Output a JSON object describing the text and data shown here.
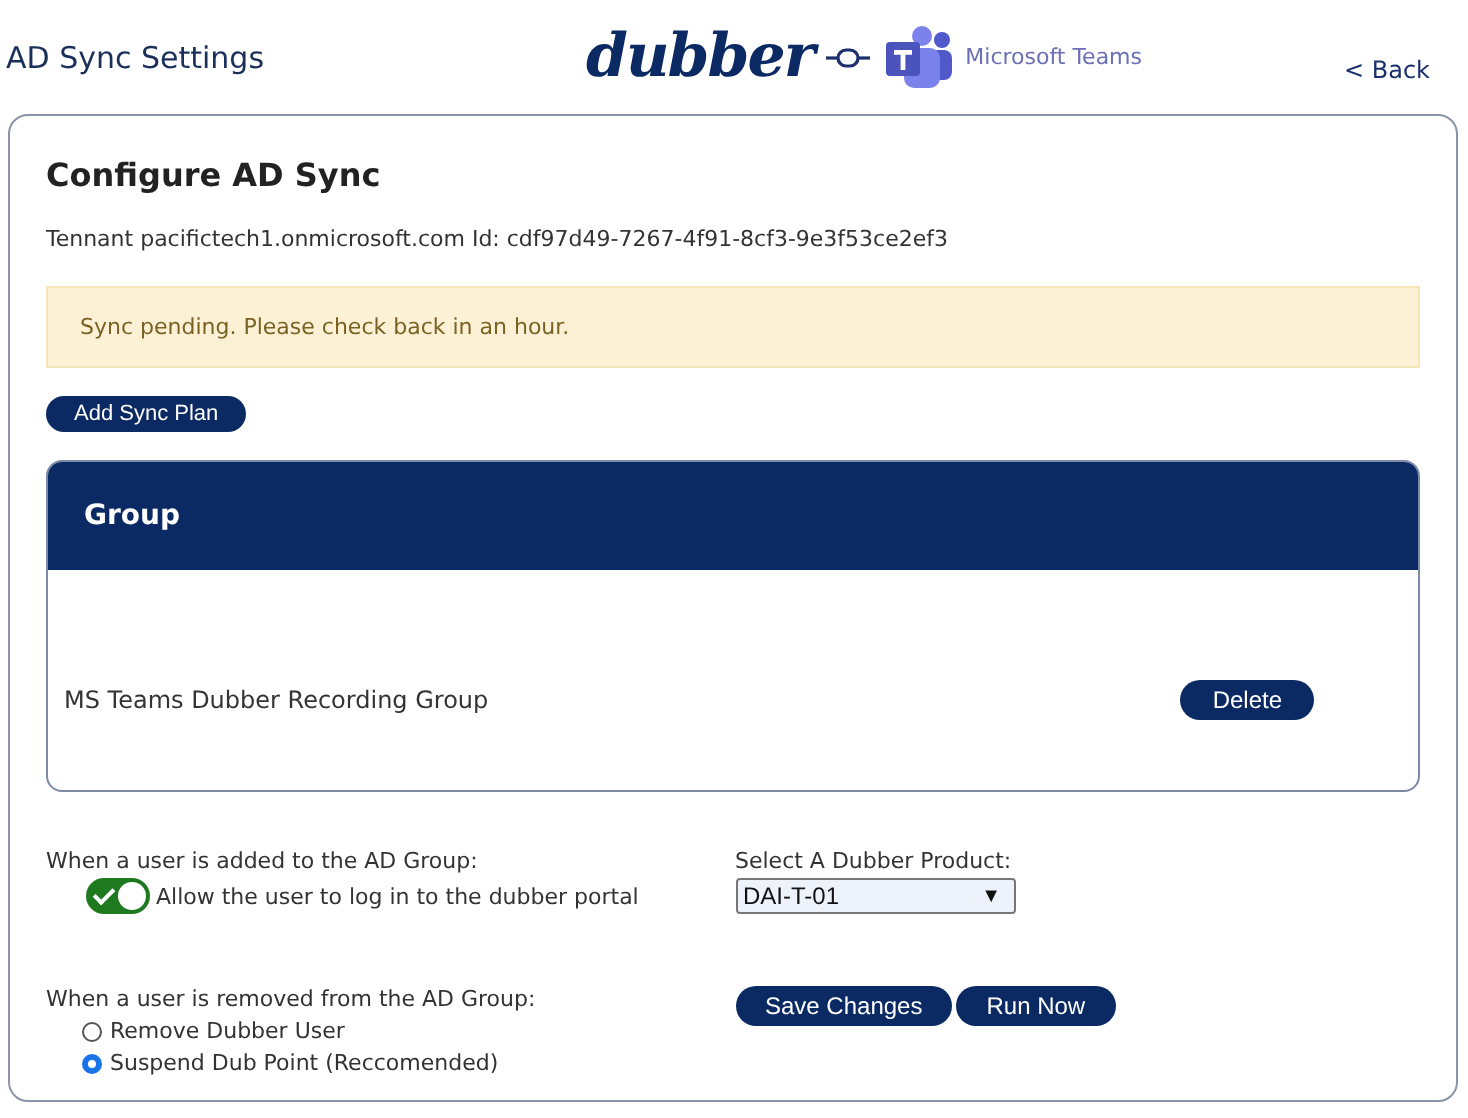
{
  "header": {
    "title": "AD Sync Settings",
    "logo_text": "dubber",
    "partner": "Microsoft Teams",
    "back": "< Back"
  },
  "card": {
    "title": "Configure AD Sync",
    "tenant": "Tennant pacifictech1.onmicrosoft.com Id: cdf97d49-7267-4f91-8cf3-9e3f53ce2ef3",
    "alert": "Sync pending. Please check back in an hour.",
    "add_button": "Add Sync Plan",
    "group_table": {
      "heading": "Group",
      "rows": [
        {
          "name": "MS Teams Dubber Recording Group",
          "action": "Delete"
        }
      ]
    },
    "added": {
      "label": "When a user is added to the AD Group:",
      "toggle": {
        "label": "Allow the user to log in to the dubber portal",
        "on": true
      }
    },
    "product": {
      "label": "Select A Dubber Product:",
      "value": "DAI-T-01",
      "arrow": "▼"
    },
    "removed": {
      "label": "When a user is removed from the AD Group:",
      "options": [
        {
          "label": "Remove Dubber User",
          "selected": false
        },
        {
          "label": "Suspend Dub Point (Reccomended)",
          "selected": true
        }
      ]
    },
    "buttons": [
      "Save Changes",
      "Run Now"
    ]
  }
}
